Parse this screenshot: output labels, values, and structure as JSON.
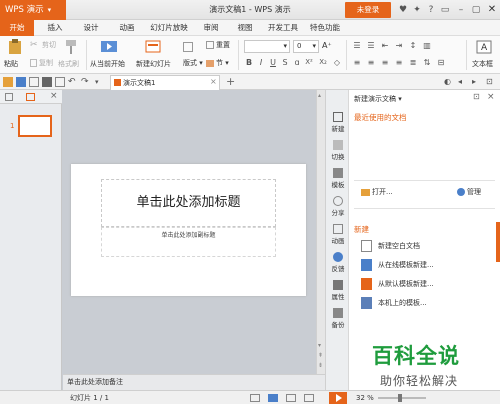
{
  "app": {
    "name": "WPS 演示",
    "window_title": "演示文稿1 - WPS 演示",
    "login_label": "未登录"
  },
  "menu": {
    "tabs": [
      "开始",
      "插入",
      "设计",
      "动画",
      "幻灯片放映",
      "审阅",
      "视图",
      "开发工具",
      "特色功能"
    ],
    "active_tab": "开始"
  },
  "ribbon": {
    "paste": "粘贴",
    "cut": "剪切",
    "copy": "复制",
    "format_painter": "格式刷",
    "from_current": "从当前开始",
    "new_slide": "新建幻灯片",
    "layout": "版式",
    "section": "节",
    "reset": "重置",
    "font_size": "0",
    "text_box": "文本框"
  },
  "quickbar": {
    "doc_tab": "演示文稿1"
  },
  "thumbnails": {
    "slide_number": "1"
  },
  "slide": {
    "title_placeholder": "单击此处添加标题",
    "subtitle_placeholder": "单击此处添加副标题"
  },
  "notes_placeholder": "单击此处添加备注",
  "sidestrip": {
    "items": [
      "新建",
      "切换",
      "模板",
      "分享",
      "动画",
      "反馈",
      "属性",
      "备份"
    ]
  },
  "taskpane": {
    "title": "新建演示文稿",
    "recent_title": "最近使用的文档",
    "open": "打开...",
    "manage": "管理",
    "new_title": "新建",
    "new_items": [
      "新建空白文档",
      "从在线模板新建...",
      "从默认模板新建...",
      "本机上的模板..."
    ]
  },
  "status": {
    "slide_counter": "幻灯片 1 / 1",
    "zoom": "32 %"
  },
  "watermark": {
    "main": "百科全说",
    "sub": "助你轻松解决"
  },
  "colors": {
    "accent": "#e5641a",
    "watermark_green": "#1f9c3d"
  }
}
